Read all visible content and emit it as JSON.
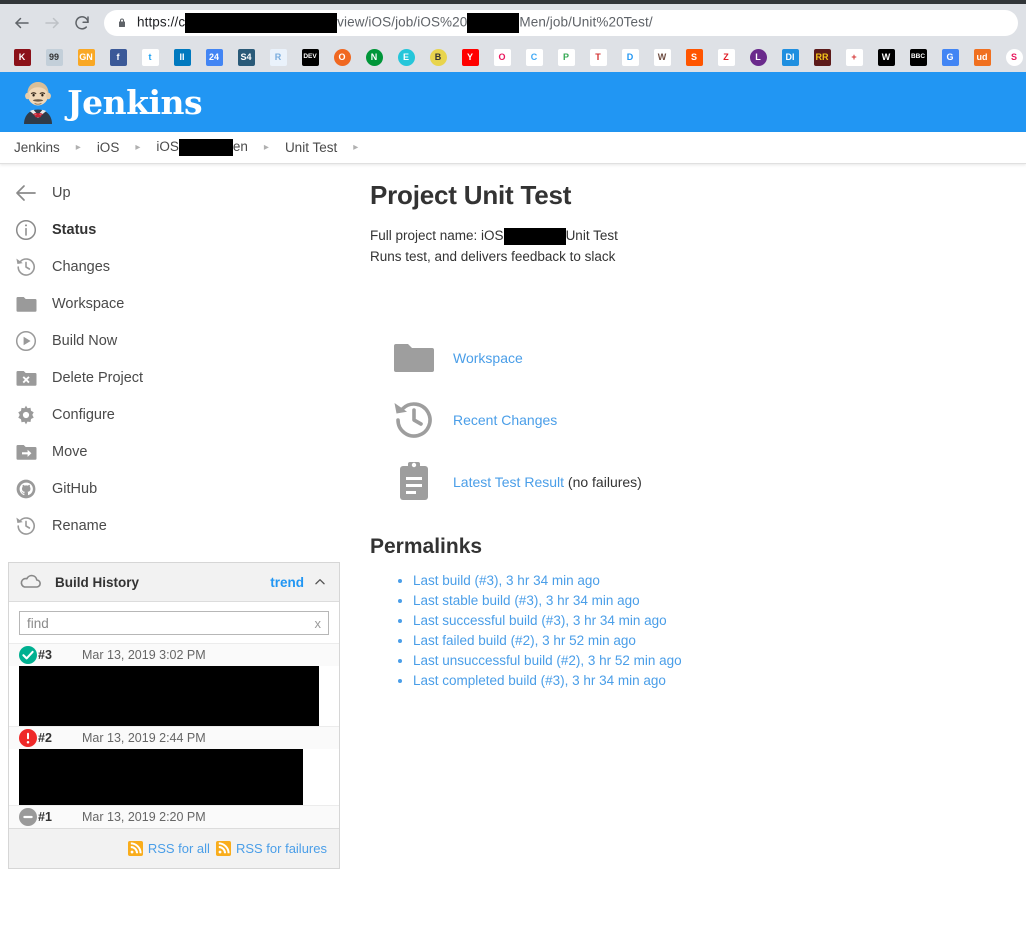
{
  "browser": {
    "back_label": "back-arrow",
    "forward_label": "forward-arrow",
    "reload_label": "reload",
    "url_prefix": "https://c",
    "url_middle": "view/iOS/job/iOS%20",
    "url_suffix": "Men/job/Unit%20Test/",
    "lock_label": "secure-lock",
    "bookmarks": [
      {
        "name": "kaltura",
        "text": "K",
        "bg": "#8b1119",
        "fg": "#ffffff",
        "shape": "square"
      },
      {
        "name": "99designs",
        "text": "99",
        "bg": "#c3cfd9",
        "fg": "#333333",
        "shape": "square"
      },
      {
        "name": "google-news",
        "text": "GN",
        "bg": "#f9a825",
        "fg": "#ffffff",
        "shape": "square"
      },
      {
        "name": "facebook",
        "text": "f",
        "bg": "#3b5998",
        "fg": "#ffffff",
        "shape": "square"
      },
      {
        "name": "twitter",
        "text": "t",
        "bg": "#ffffff",
        "fg": "#1da1f2",
        "shape": "square"
      },
      {
        "name": "trello",
        "text": "II",
        "bg": "#0079bf",
        "fg": "#ffffff",
        "shape": "square"
      },
      {
        "name": "calendar-24",
        "text": "24",
        "bg": "#4285f4",
        "fg": "#ffffff",
        "shape": "square"
      },
      {
        "name": "s4",
        "text": "S4",
        "bg": "#2a5a78",
        "fg": "#ffffff",
        "shape": "square"
      },
      {
        "name": "r-project",
        "text": "R",
        "bg": "#eaf2fb",
        "fg": "#7aadde",
        "shape": "square"
      },
      {
        "name": "dev-to",
        "text": "DEV",
        "bg": "#000000",
        "fg": "#ffffff",
        "shape": "square"
      },
      {
        "name": "openvpn",
        "text": "O",
        "bg": "#f06821",
        "fg": "#ffffff",
        "shape": "circ"
      },
      {
        "name": "nginx",
        "text": "N",
        "bg": "#009639",
        "fg": "#ffffff",
        "shape": "circ"
      },
      {
        "name": "evernote",
        "text": "E",
        "bg": "#25c6da",
        "fg": "#ffffff",
        "shape": "circ"
      },
      {
        "name": "smiley",
        "text": "B",
        "bg": "#e8d44d",
        "fg": "#333333",
        "shape": "circ"
      },
      {
        "name": "youtube",
        "text": "Y",
        "bg": "#ff0000",
        "fg": "#ffffff",
        "shape": "square"
      },
      {
        "name": "reset-loop",
        "text": "O",
        "bg": "#ffffff",
        "fg": "#e8185e",
        "shape": "square"
      },
      {
        "name": "cloud-down",
        "text": "C",
        "bg": "#ffffff",
        "fg": "#3fa9f5",
        "shape": "square"
      },
      {
        "name": "google-play",
        "text": "P",
        "bg": "#ffffff",
        "fg": "#34a853",
        "shape": "square"
      },
      {
        "name": "thermometer",
        "text": "T",
        "bg": "#ffffff",
        "fg": "#d32f2f",
        "shape": "square"
      },
      {
        "name": "water-drop",
        "text": "D",
        "bg": "#ffffff",
        "fg": "#2196f3",
        "shape": "square"
      },
      {
        "name": "wifi-signal",
        "text": "W",
        "bg": "#ffffff",
        "fg": "#6d4c41",
        "shape": "square"
      },
      {
        "name": "soundcloud",
        "text": "S",
        "bg": "#ff5500",
        "fg": "#ffffff",
        "shape": "square"
      },
      {
        "name": "red-swoosh",
        "text": "Z",
        "bg": "#ffffff",
        "fg": "#e01b24",
        "shape": "square"
      },
      {
        "name": "purple-badge",
        "text": "L",
        "bg": "#6a2a8c",
        "fg": "#ffffff",
        "shape": "circ"
      },
      {
        "name": "di-logo",
        "text": "DI",
        "bg": "#1f8fe0",
        "fg": "#ffffff",
        "shape": "square"
      },
      {
        "name": "rr-logo",
        "text": "RR",
        "bg": "#5c1a1a",
        "fg": "#f5c518",
        "shape": "square"
      },
      {
        "name": "red-cross",
        "text": "+",
        "bg": "#ffffff",
        "fg": "#d32f2f",
        "shape": "square"
      },
      {
        "name": "w-spr",
        "text": "W",
        "bg": "#000000",
        "fg": "#ffffff",
        "shape": "square"
      },
      {
        "name": "bbc",
        "text": "BBC",
        "bg": "#000000",
        "fg": "#ffffff",
        "shape": "square"
      },
      {
        "name": "google-star",
        "text": "G",
        "bg": "#4285f4",
        "fg": "#ffffff",
        "shape": "square"
      },
      {
        "name": "ud-logo",
        "text": "ud",
        "bg": "#f07020",
        "fg": "#ffffff",
        "shape": "square"
      },
      {
        "name": "sync-circle",
        "text": "S",
        "bg": "#ffffff",
        "fg": "#e8185e",
        "shape": "circ"
      }
    ]
  },
  "header": {
    "wordmark": "Jenkins"
  },
  "breadcrumb": {
    "items": [
      "Jenkins",
      "iOS",
      "iOS",
      "Unit Test"
    ],
    "redacted_tail": "en"
  },
  "sidebar": {
    "items": [
      {
        "label": "Up",
        "icon": "arrow-left-icon",
        "bold": false
      },
      {
        "label": "Status",
        "icon": "info-circle-icon",
        "bold": true
      },
      {
        "label": "Changes",
        "icon": "history-clock-icon",
        "bold": false
      },
      {
        "label": "Workspace",
        "icon": "folder-icon",
        "bold": false
      },
      {
        "label": "Build Now",
        "icon": "play-circle-icon",
        "bold": false
      },
      {
        "label": "Delete Project",
        "icon": "folder-x-icon",
        "bold": false
      },
      {
        "label": "Configure",
        "icon": "gear-icon",
        "bold": false
      },
      {
        "label": "Move",
        "icon": "folder-arrow-icon",
        "bold": false
      },
      {
        "label": "GitHub",
        "icon": "github-icon",
        "bold": false
      },
      {
        "label": "Rename",
        "icon": "history-clock-icon",
        "bold": false
      }
    ]
  },
  "build_history": {
    "title": "Build History",
    "trend_label": "trend",
    "find_placeholder": "find",
    "find_value": "",
    "clear_label": "x",
    "builds": [
      {
        "number": "#3",
        "date": "Mar 13, 2019 3:02 PM",
        "status": "success"
      },
      {
        "number": "#2",
        "date": "Mar 13, 2019 2:44 PM",
        "status": "failed"
      },
      {
        "number": "#1",
        "date": "Mar 13, 2019 2:20 PM",
        "status": "aborted"
      }
    ],
    "rss_all": "RSS for all",
    "rss_failures": "RSS for failures"
  },
  "main": {
    "title": "Project Unit Test",
    "full_name_prefix": "Full project name: iOS",
    "full_name_suffix": "Unit Test",
    "description": "Runs test, and delivers feedback to slack",
    "actions": [
      {
        "label": "Workspace",
        "suffix": "",
        "icon": "folder-icon"
      },
      {
        "label": "Recent Changes",
        "suffix": "",
        "icon": "history-clock-icon"
      },
      {
        "label": "Latest Test Result",
        "suffix": " (no failures)",
        "icon": "clipboard-icon"
      }
    ],
    "permalinks_title": "Permalinks",
    "permalinks": [
      "Last build (#3), 3 hr 34 min ago",
      "Last stable build (#3), 3 hr 34 min ago",
      "Last successful build (#3), 3 hr 34 min ago",
      "Last failed build (#2), 3 hr 52 min ago",
      "Last unsuccessful build (#2), 3 hr 52 min ago",
      "Last completed build (#3), 3 hr 34 min ago"
    ]
  },
  "colors": {
    "jenkins_blue": "#2196f3",
    "link_blue": "#4a9ee8",
    "success_green": "#00b091",
    "failure_red": "#ef2929",
    "aborted_gray": "#9a9a9a",
    "rss_orange": "#f9ad1c"
  }
}
